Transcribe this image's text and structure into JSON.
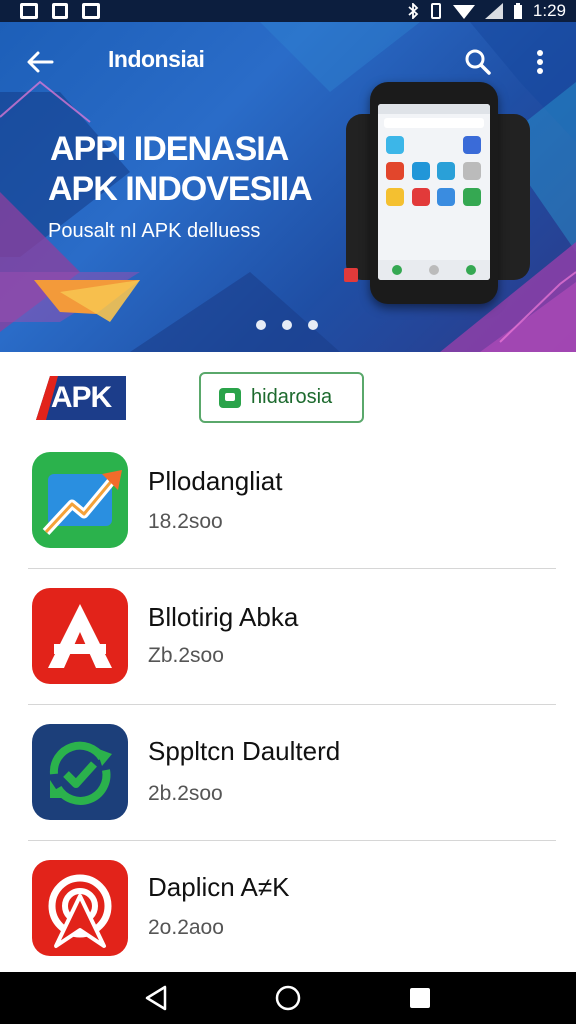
{
  "status_bar": {
    "time": "1:29",
    "icons": [
      "notification-icon",
      "notification-icon",
      "notification-icon",
      "bluetooth-icon",
      "vibrate-icon",
      "wifi-icon",
      "signal-icon",
      "battery-icon"
    ]
  },
  "toolbar": {
    "title": "Indonsiai",
    "icons": [
      "back-arrow-icon",
      "search-icon",
      "more-vert-icon"
    ]
  },
  "banner": {
    "headline_1": "APPI IDENASIA",
    "headline_2": "APK INDOVESIIA",
    "subline": "Pousalt nI APK delluess",
    "carousel_dots": 3
  },
  "badges": {
    "apk_label": "APK",
    "brand_label": "hidarosia"
  },
  "apps": [
    {
      "name": "Pllodangliat",
      "meta": "18.2soo",
      "icon": "chart-arrow-icon",
      "color": "#2bb24c"
    },
    {
      "name": "Bllotirig Abka",
      "meta": "Zb.2soo",
      "icon": "letter-a-icon",
      "color": "#e2231a"
    },
    {
      "name": "Sppltcn Daulterd",
      "meta": "2b.2soo",
      "icon": "refresh-check-icon",
      "color": "#1c3f7a"
    },
    {
      "name": "Daplicn A≠K",
      "meta": "2o.2aoo",
      "icon": "target-icon",
      "color": "#e2231a"
    }
  ],
  "nav_bar": {
    "icons": [
      "back-triangle-icon",
      "home-circle-icon",
      "recents-square-icon"
    ]
  }
}
